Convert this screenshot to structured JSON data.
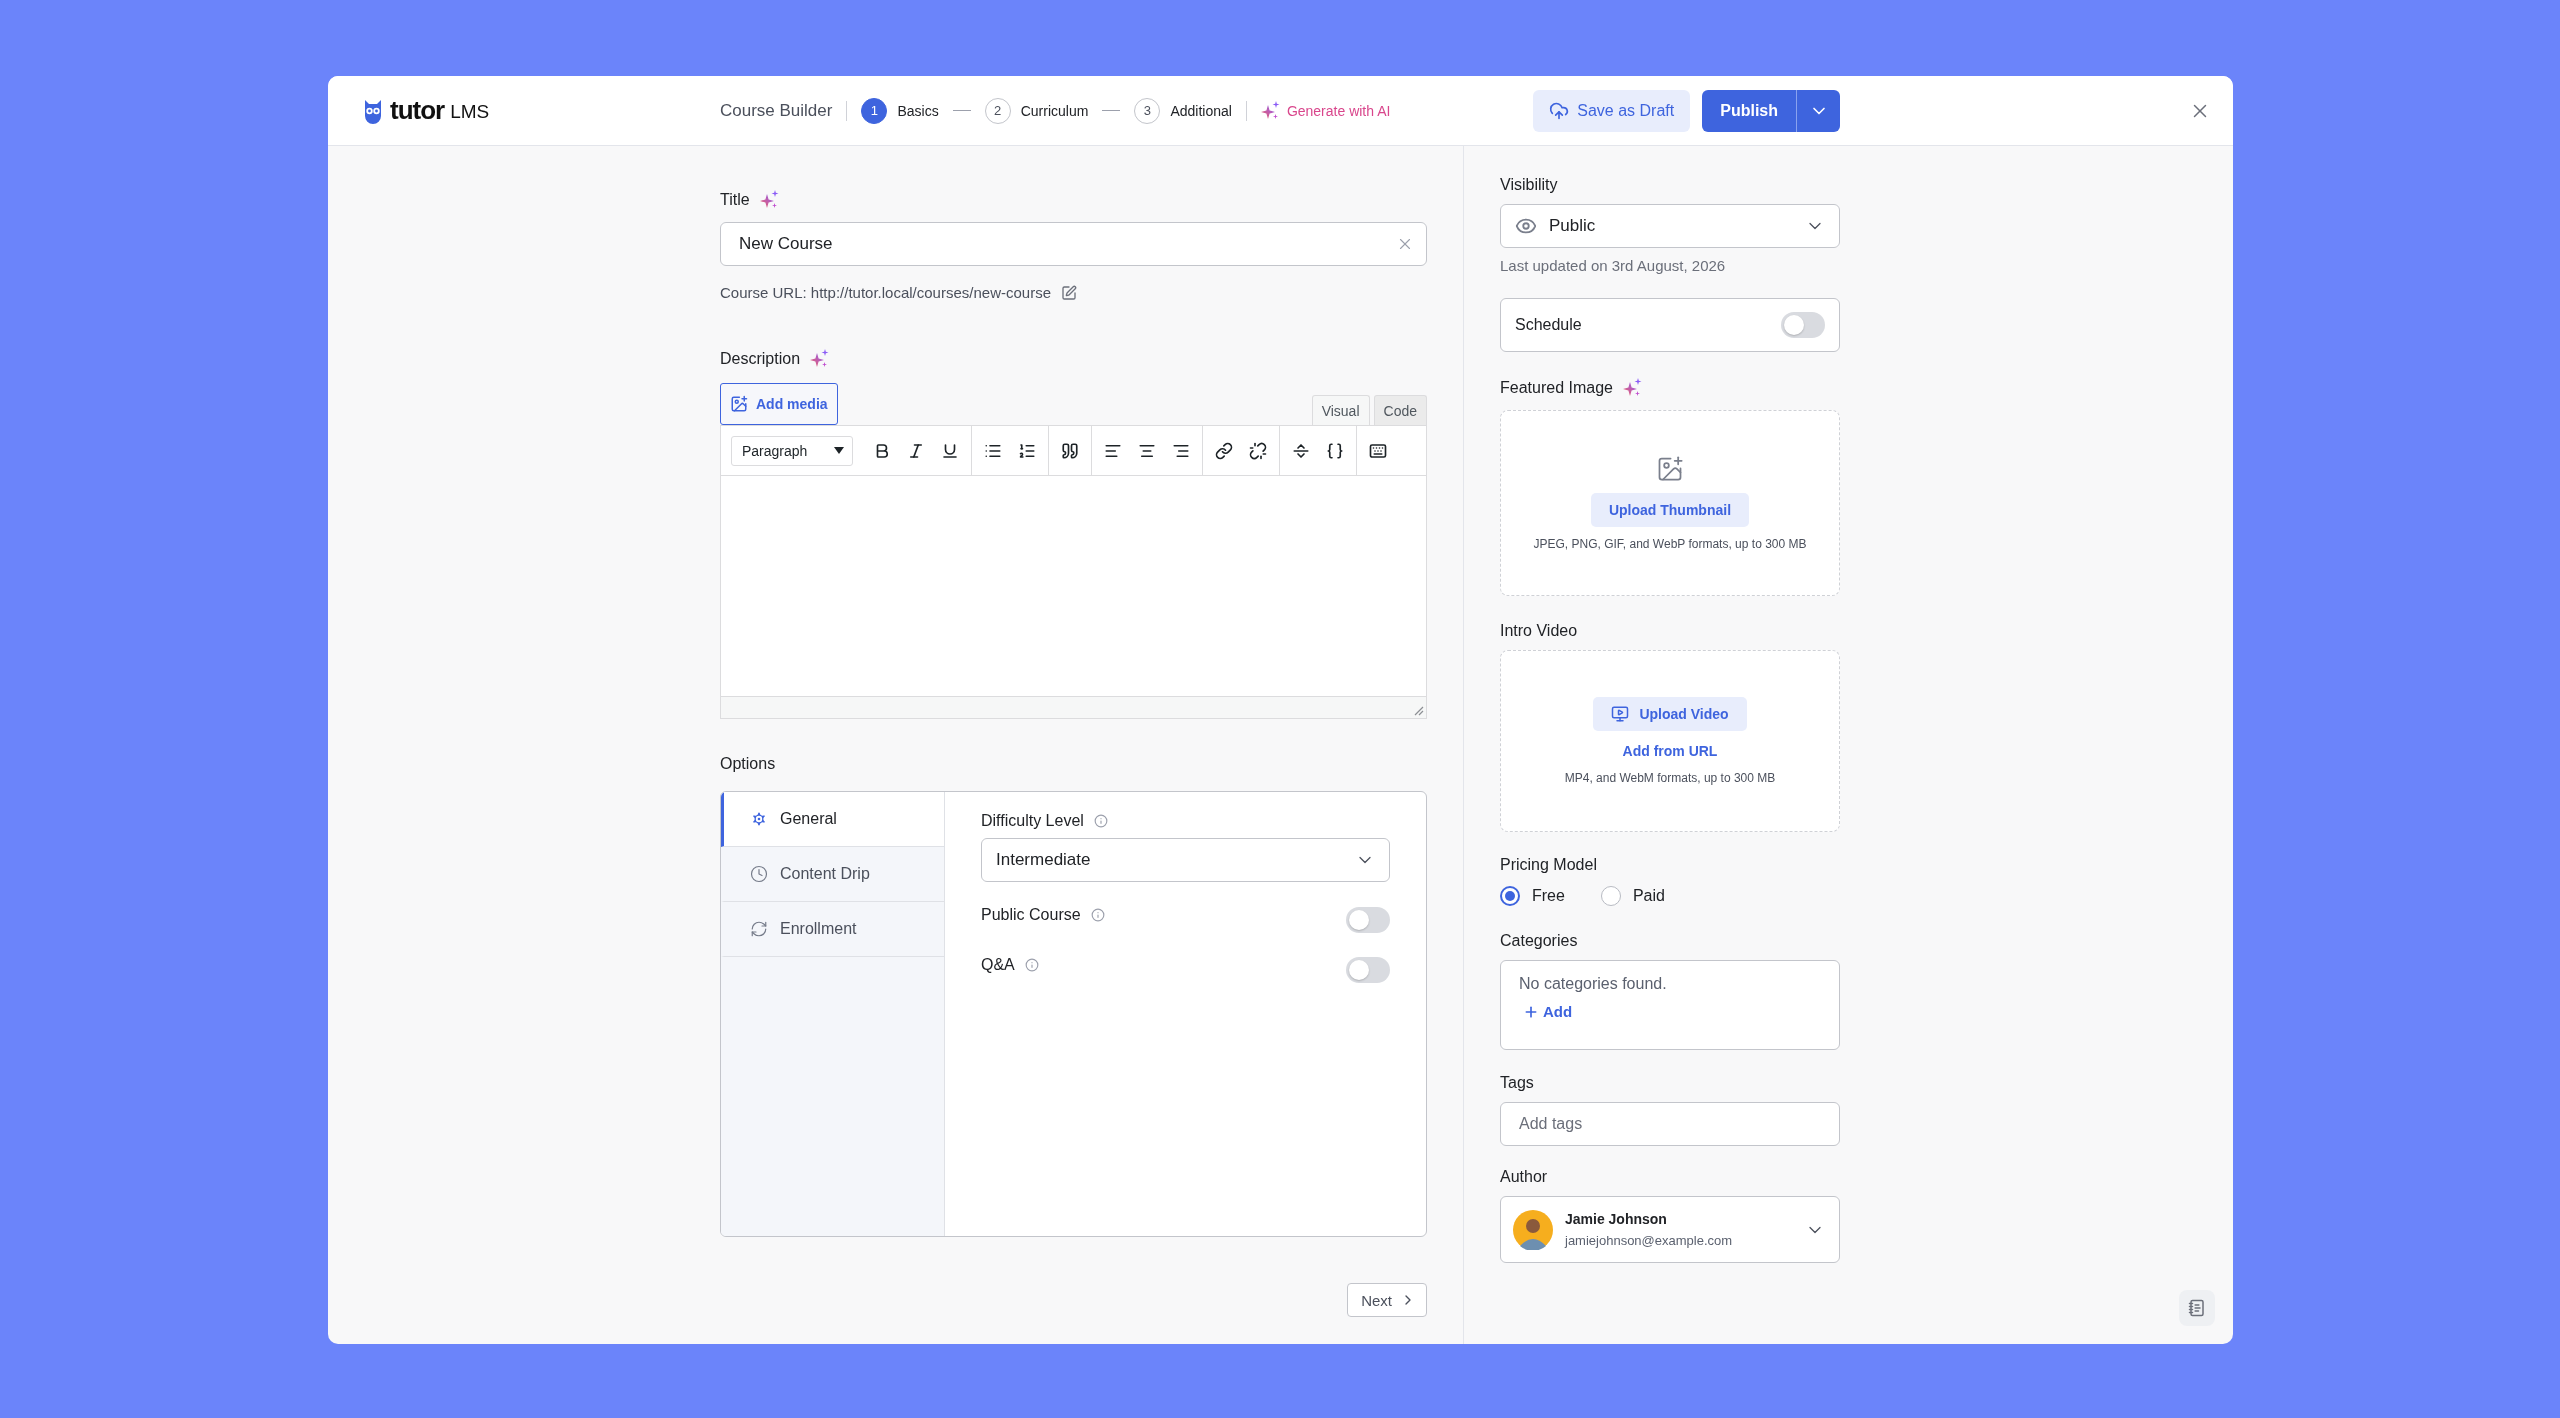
{
  "header": {
    "logo": {
      "word": "tutor",
      "suffix": "LMS"
    },
    "title": "Course Builder",
    "steps": [
      {
        "number": "1",
        "label": "Basics",
        "selected": true
      },
      {
        "number": "2",
        "label": "Curriculum",
        "selected": false
      },
      {
        "number": "3",
        "label": "Additional",
        "selected": false
      }
    ],
    "ai_link": "Generate with AI",
    "draft_button": "Save as Draft",
    "publish_button": "Publish"
  },
  "main": {
    "title_field": {
      "label": "Title",
      "value": "New Course"
    },
    "course_url": "Course URL: http://tutor.local/courses/new-course",
    "description": {
      "label": "Description",
      "add_media": "Add media",
      "format": "Paragraph",
      "editor_tabs": [
        {
          "label": "Visual",
          "selected": true
        },
        {
          "label": "Code",
          "selected": false
        }
      ]
    },
    "options": {
      "label": "Options",
      "tabs": [
        {
          "label": "General",
          "selected": true
        },
        {
          "label": "Content Drip",
          "selected": false
        },
        {
          "label": "Enrollment",
          "selected": false
        }
      ],
      "difficulty": {
        "label": "Difficulty Level",
        "value": "Intermediate"
      },
      "toggles": [
        {
          "label": "Public Course",
          "on": false
        },
        {
          "label": "Q&A",
          "on": false
        }
      ]
    },
    "next_button": "Next"
  },
  "sidebar": {
    "visibility": {
      "label": "Visibility",
      "value": "Public"
    },
    "last_updated": "Last updated on 3rd August, 2026",
    "schedule": {
      "label": "Schedule",
      "on": false
    },
    "featured_image": {
      "label": "Featured Image",
      "button": "Upload Thumbnail",
      "note": "JPEG, PNG, GIF, and WebP formats, up to 300 MB"
    },
    "intro_video": {
      "label": "Intro Video",
      "button": "Upload Video",
      "link": "Add from URL",
      "note": "MP4, and WebM formats, up to 300 MB"
    },
    "pricing": {
      "label": "Pricing Model",
      "options": [
        {
          "label": "Free",
          "selected": true
        },
        {
          "label": "Paid",
          "selected": false
        }
      ]
    },
    "categories": {
      "label": "Categories",
      "empty": "No categories found.",
      "add": "Add"
    },
    "tags": {
      "label": "Tags",
      "placeholder": "Add tags"
    },
    "author": {
      "label": "Author",
      "name": "Jamie Johnson",
      "email": "jamiejohnson@example.com"
    }
  }
}
